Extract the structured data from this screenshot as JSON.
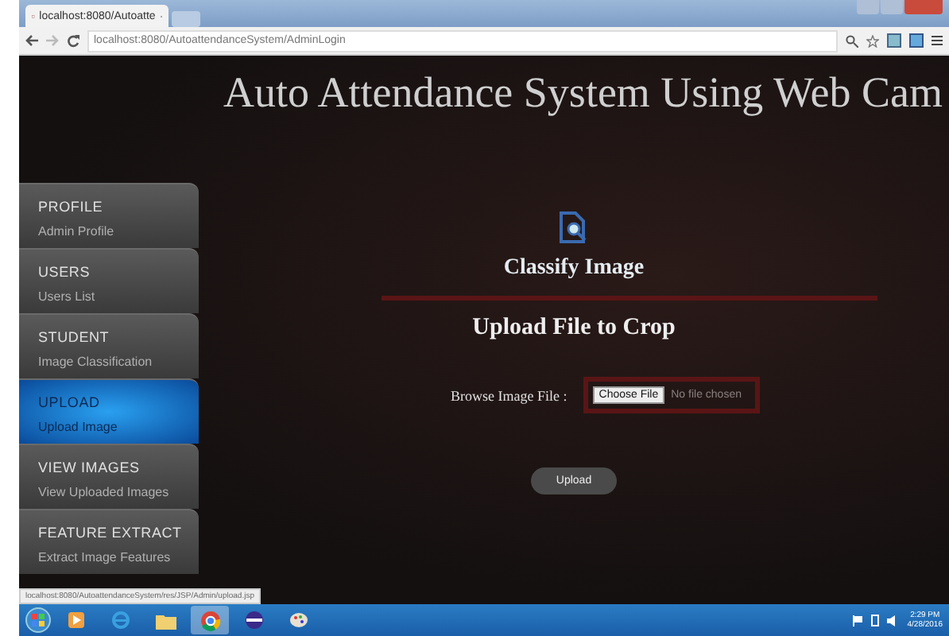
{
  "browser": {
    "tab_title": "localhost:8080/Autoatte",
    "address": "localhost:8080/AutoattendanceSystem/AdminLogin"
  },
  "page": {
    "title": "Auto Attendance System Using Web Cam"
  },
  "sidebar": {
    "items": [
      {
        "title": "PROFILE",
        "subtitle": "Admin Profile",
        "selected": false
      },
      {
        "title": "USERS",
        "subtitle": "Users List",
        "selected": false
      },
      {
        "title": "STUDENT",
        "subtitle": "Image Classification",
        "selected": false
      },
      {
        "title": "UPLOAD",
        "subtitle": "Upload Image",
        "selected": true
      },
      {
        "title": "VIEW IMAGES",
        "subtitle": "View Uploaded Images",
        "selected": false
      },
      {
        "title": "FEATURE EXTRACT",
        "subtitle": "Extract Image Features",
        "selected": false
      }
    ]
  },
  "main": {
    "heading": "Classify Image",
    "subheading": "Upload File to Crop",
    "browse_label": "Browse Image File :",
    "choose_button": "Choose File",
    "file_status": "No file chosen",
    "upload_button": "Upload"
  },
  "status_bar": "localhost:8080/AutoattendanceSystem/res/JSP/Admin/upload.jsp",
  "taskbar": {
    "apps": [
      {
        "kind": "media",
        "selected": false
      },
      {
        "kind": "ie",
        "selected": false
      },
      {
        "kind": "folder",
        "selected": false
      },
      {
        "kind": "chrome",
        "selected": true
      },
      {
        "kind": "eclipse",
        "selected": false
      },
      {
        "kind": "paint",
        "selected": false
      }
    ],
    "time": "2:29 PM",
    "date": "4/28/2016"
  }
}
